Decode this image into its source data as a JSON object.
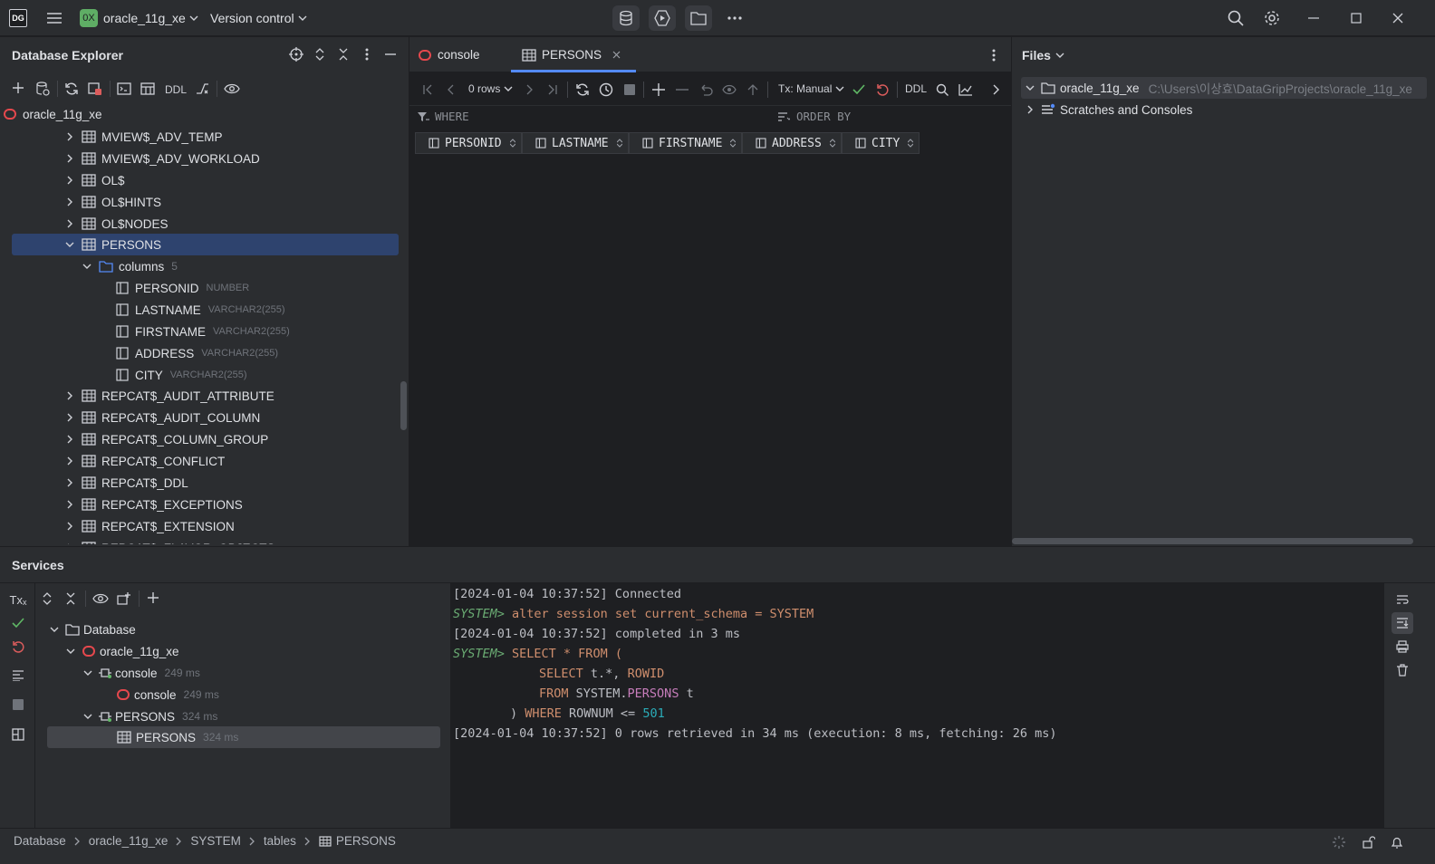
{
  "titlebar": {
    "logo": "DG",
    "project_badge": "0X",
    "project": "oracle_11g_xe",
    "vcs": "Version control"
  },
  "db_explorer": {
    "title": "Database Explorer",
    "toolbar_ddl": "DDL",
    "root": "oracle_11g_xe",
    "tables_before": [
      "MVIEW$_ADV_TEMP",
      "MVIEW$_ADV_WORKLOAD",
      "OL$",
      "OL$HINTS",
      "OL$NODES"
    ],
    "selected_table": "PERSONS",
    "columns_folder": {
      "label": "columns",
      "count": "5"
    },
    "columns": [
      {
        "name": "PERSONID",
        "type": "NUMBER"
      },
      {
        "name": "LASTNAME",
        "type": "VARCHAR2(255)"
      },
      {
        "name": "FIRSTNAME",
        "type": "VARCHAR2(255)"
      },
      {
        "name": "ADDRESS",
        "type": "VARCHAR2(255)"
      },
      {
        "name": "CITY",
        "type": "VARCHAR2(255)"
      }
    ],
    "tables_after": [
      "REPCAT$_AUDIT_ATTRIBUTE",
      "REPCAT$_AUDIT_COLUMN",
      "REPCAT$_COLUMN_GROUP",
      "REPCAT$_CONFLICT",
      "REPCAT$_DDL",
      "REPCAT$_EXCEPTIONS",
      "REPCAT$_EXTENSION",
      "REPCAT$_FLAVOR_OBJECTS"
    ]
  },
  "editor": {
    "tabs": [
      {
        "label": "console"
      },
      {
        "label": "PERSONS"
      }
    ],
    "rows_label": "0 rows",
    "tx_label": "Tx: Manual",
    "ddl_label": "DDL",
    "where_label": "WHERE",
    "order_label": "ORDER BY",
    "columns": [
      "PERSONID",
      "LASTNAME",
      "FIRSTNAME",
      "ADDRESS",
      "CITY"
    ]
  },
  "files": {
    "title": "Files",
    "project": "oracle_11g_xe",
    "path": "C:\\Users\\이상효\\DataGripProjects\\oracle_11g_xe",
    "scratches": "Scratches and Consoles"
  },
  "services": {
    "title": "Services",
    "tx_label": "Tx",
    "tree": {
      "database": "Database",
      "datasource": "oracle_11g_xe",
      "console_group": {
        "label": "console",
        "time": "249 ms"
      },
      "console_item": {
        "label": "console",
        "time": "249 ms"
      },
      "persons_group": {
        "label": "PERSONS",
        "time": "324 ms"
      },
      "persons_item": {
        "label": "PERSONS",
        "time": "324 ms"
      }
    },
    "log": {
      "l1": "[2024-01-04 10:37:52] Connected",
      "l2_prompt": "SYSTEM>",
      "l2_rest": " alter session set current_schema = SYSTEM",
      "l3": "[2024-01-04 10:37:52] completed in 3 ms",
      "l4_prompt": "SYSTEM>",
      "l4_rest": " SELECT * FROM (",
      "l5_a": "SELECT",
      "l5_b": " t.*, ",
      "l5_c": "ROWID",
      "l6_a": "FROM",
      "l6_b": " SYSTEM.",
      "l6_c": "PERSONS",
      "l6_d": " t",
      "l7_a": ") ",
      "l7_b": "WHERE",
      "l7_c": " ROWNUM <= ",
      "l7_d": "501",
      "l8": "[2024-01-04 10:37:52] 0 rows retrieved in 34 ms (execution: 8 ms, fetching: 26 ms)"
    }
  },
  "statusbar": {
    "crumbs": [
      "Database",
      "oracle_11g_xe",
      "SYSTEM",
      "tables",
      "PERSONS"
    ]
  }
}
